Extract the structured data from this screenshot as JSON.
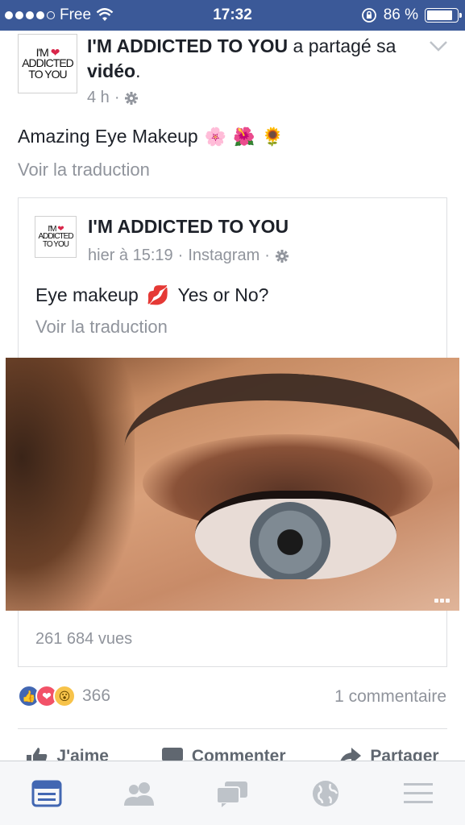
{
  "status_bar": {
    "carrier": "Free",
    "time": "17:32",
    "battery_percent_label": "86 %",
    "battery_level": 0.86
  },
  "post": {
    "page_logo_lines": [
      "I'M",
      "ADDICTED",
      "TO YOU"
    ],
    "author": "I'M ADDICTED TO YOU",
    "action_prefix": "a partagé",
    "action_middle": "sa",
    "action_object": "vidéo",
    "action_suffix": ".",
    "time_ago": "4 h",
    "caption": "Amazing Eye Makeup",
    "caption_emojis": [
      "🌸",
      "🌺",
      "🌻"
    ],
    "see_translation": "Voir la traduction"
  },
  "shared_post": {
    "page_logo_lines": [
      "I'M",
      "ADDICTED",
      "TO YOU"
    ],
    "author": "I'M ADDICTED TO YOU",
    "timestamp": "hier à 15:19",
    "source": "Instagram",
    "caption_start": "Eye makeup",
    "caption_emoji": "💋",
    "caption_end": "Yes or No?",
    "see_translation": "Voir la traduction",
    "views": "261 684 vues"
  },
  "engagement": {
    "reaction_count": "366",
    "comments": "1 commentaire"
  },
  "actions": {
    "like": "J'aime",
    "comment": "Commenter",
    "share": "Partager"
  },
  "tab_bar": {
    "tabs": [
      "news-feed",
      "friends",
      "messages",
      "notifications",
      "menu"
    ],
    "active": "news-feed"
  },
  "colors": {
    "brand_blue": "#3b5998",
    "meta_gray": "#90949c",
    "like_blue": "#4267b2",
    "love_red": "#f25268",
    "wow_yellow": "#f7c34a"
  }
}
